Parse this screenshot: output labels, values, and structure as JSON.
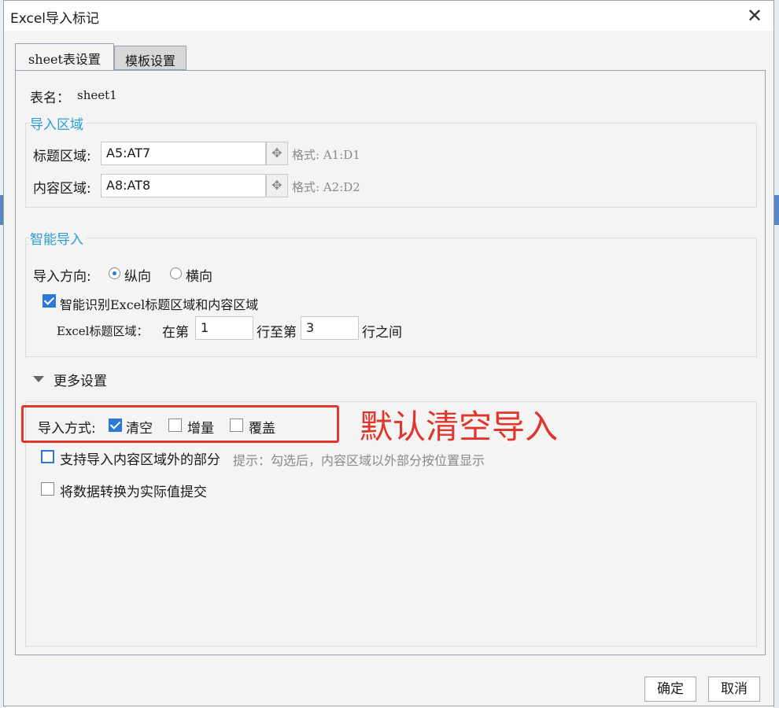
{
  "window": {
    "title": "Excel导入标记",
    "close_label": "✕"
  },
  "tabs": [
    {
      "label": "sheet表设置",
      "active": true
    },
    {
      "label": "模板设置",
      "active": false
    }
  ],
  "sheet": {
    "label": "表名：",
    "value": "sheet1"
  },
  "import_area": {
    "title": "导入区域",
    "header_label": "标题区域:",
    "header_value": "A5:AT7",
    "header_format": "格式: A1:D1",
    "content_label": "内容区域:",
    "content_value": "A8:AT8",
    "content_format": "格式: A2:D2",
    "picker_icon": "move-arrows-icon"
  },
  "smart_import": {
    "title": "智能导入",
    "direction_label": "导入方向:",
    "vertical_label": "纵向",
    "horizontal_label": "横向",
    "selected_direction": "纵向",
    "auto_detect_label": "智能识别Excel标题区域和内容区域",
    "auto_detect_checked": true,
    "range_label": "Excel标题区域：",
    "from_label": "在第",
    "from_value": "1",
    "to_label": "行至第",
    "to_value": "3",
    "between_label": "行之间"
  },
  "more_settings": {
    "title": "更多设置",
    "mode_label": "导入方式:",
    "mode_clear": "清空",
    "mode_increment": "增量",
    "mode_overwrite": "覆盖",
    "clear_checked": true,
    "support_outside_label": "支持导入内容区域外的部分",
    "support_outside_hint": "提示：勾选后，内容区域以外部分按位置显示",
    "convert_label": "将数据转换为实际值提交"
  },
  "annotation": {
    "text": "默认清空导入",
    "color": "#e0362b"
  },
  "buttons": {
    "ok": "确定",
    "cancel": "取消"
  },
  "colors": {
    "accent": "#2a9fd6",
    "checkbox": "#2b78d6"
  }
}
